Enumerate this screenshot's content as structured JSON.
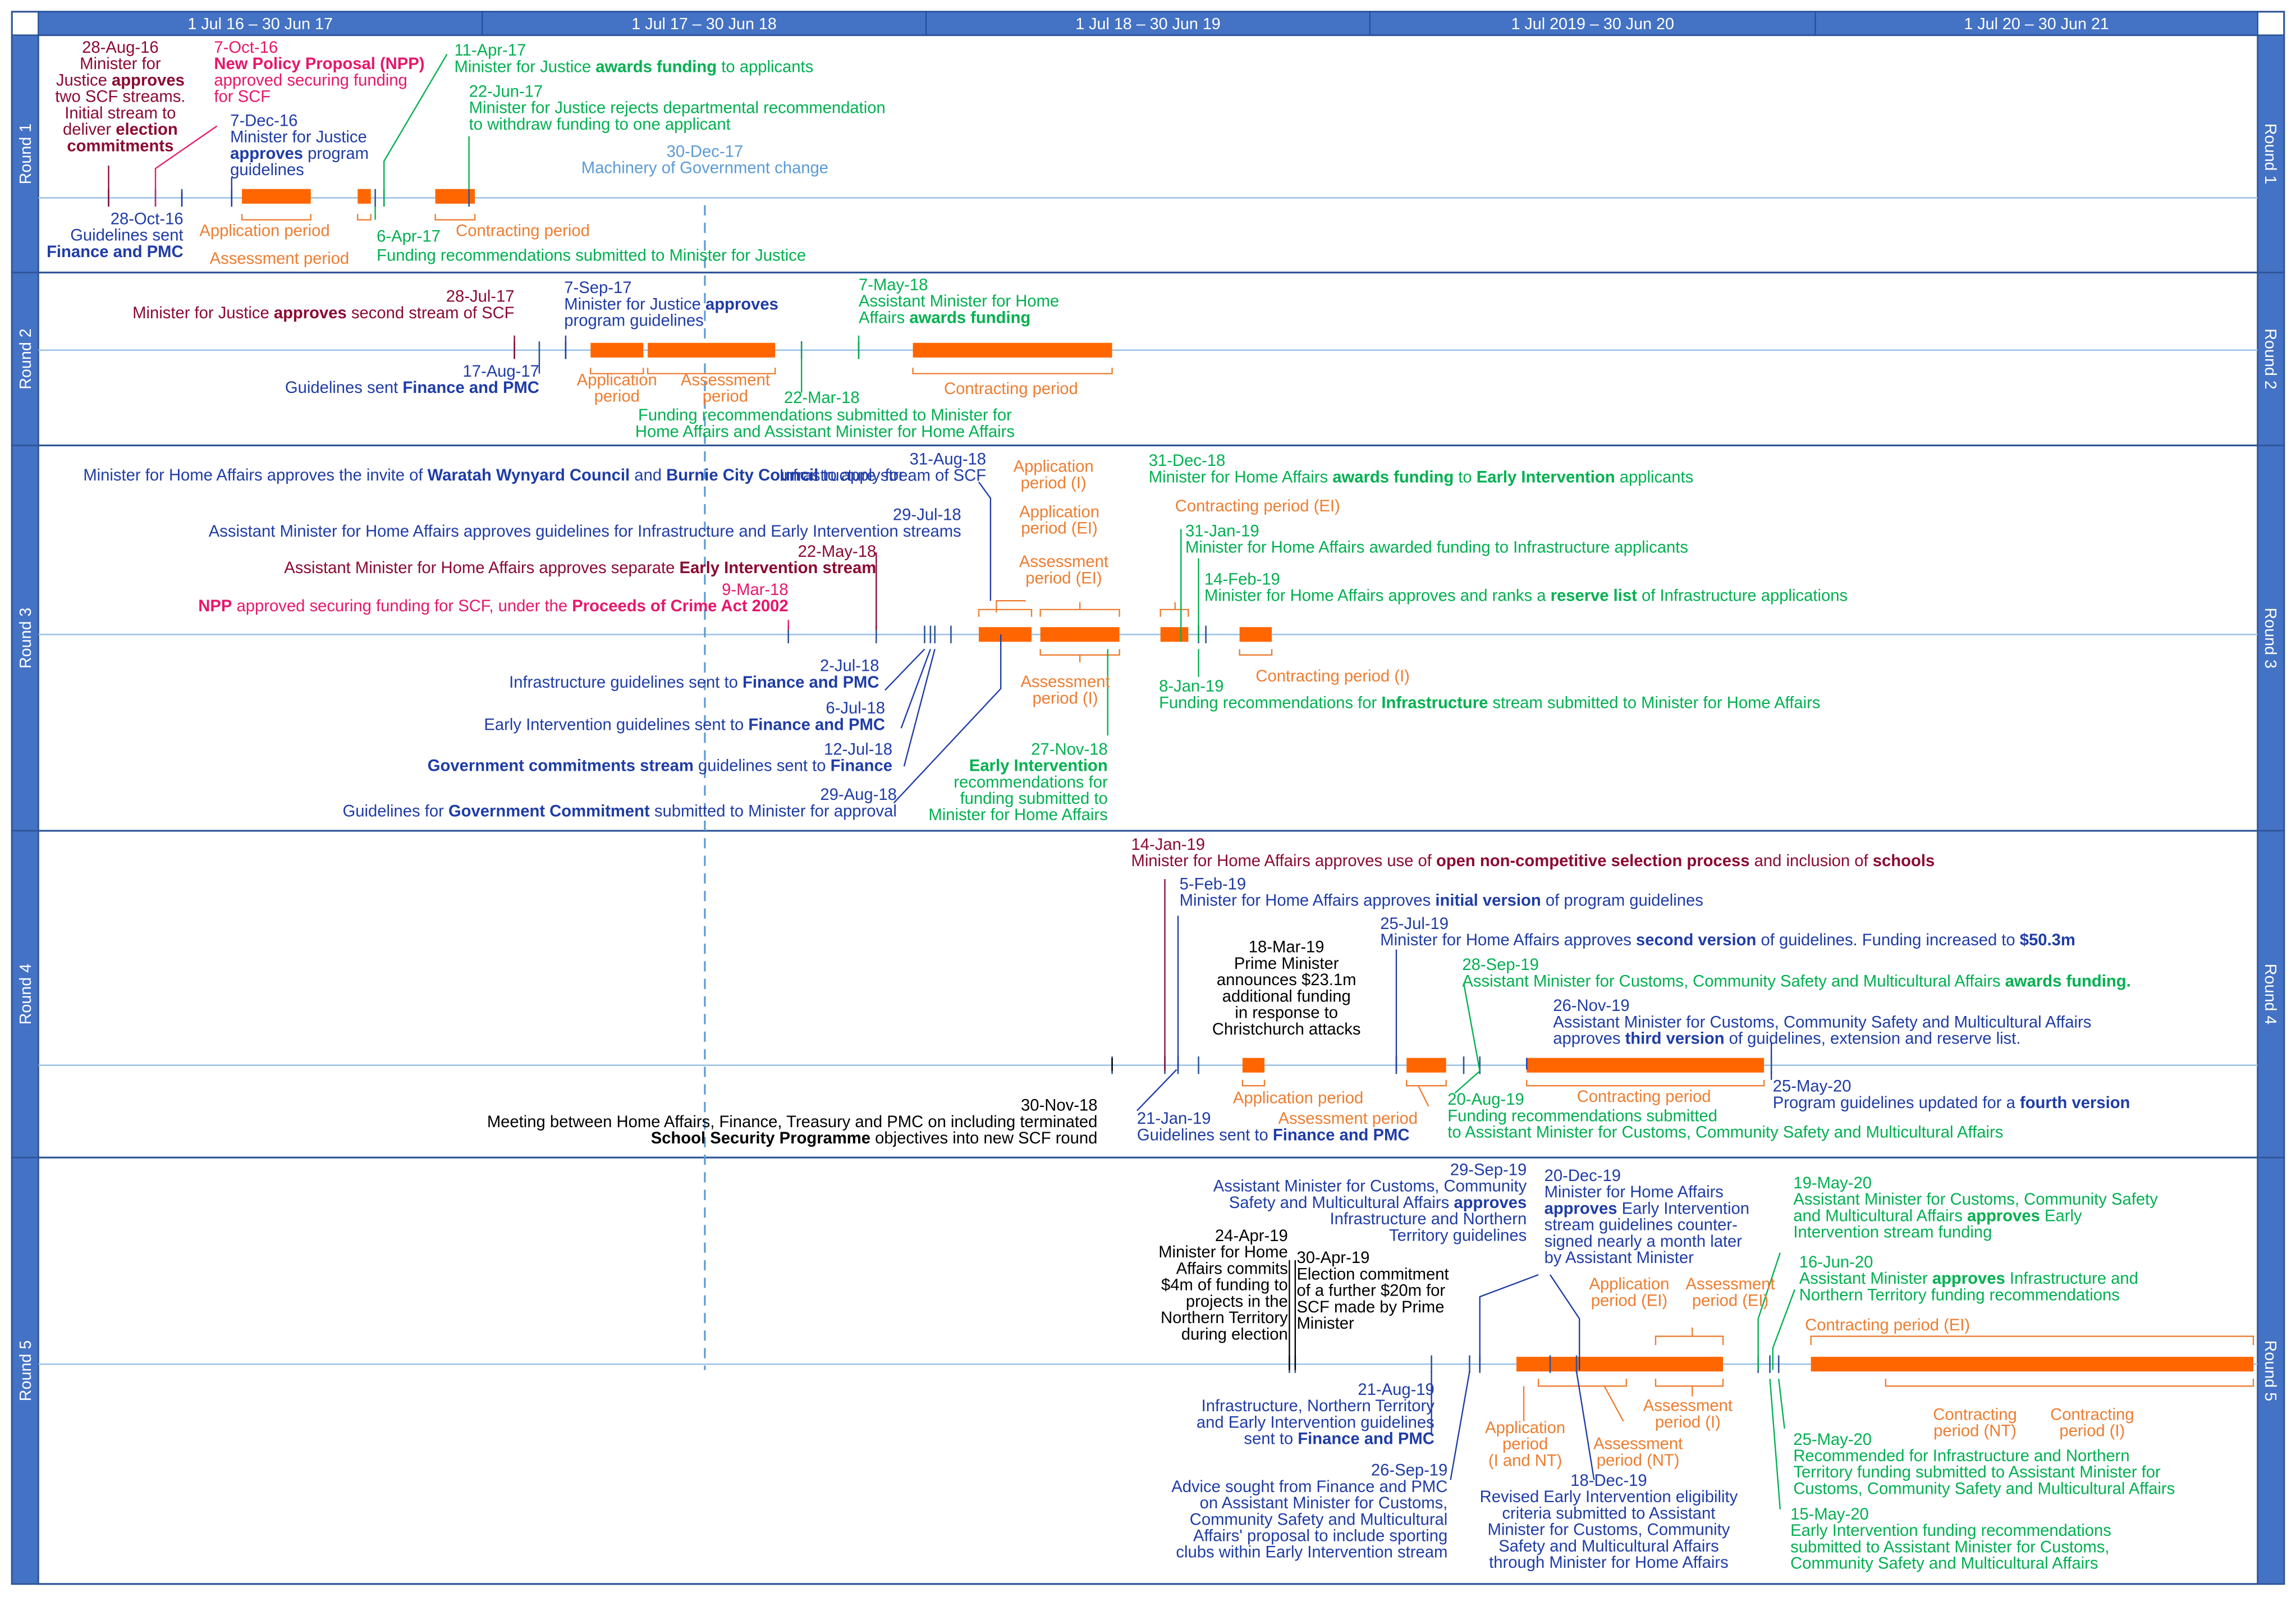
{
  "colors": {
    "header_blue": "#4472C4",
    "frame_blue": "#2F5597",
    "axis_line": "#9DC3E6",
    "bar_orange": "#FF6600",
    "label_orange": "#ED7D31",
    "maroon": "#8B0A32",
    "pink": "#E6176B",
    "dark_blue": "#1F3CA6",
    "green": "#00B050",
    "mog_blue": "#5B9BD5",
    "black": "#000000"
  },
  "years": [
    "1 Jul 16 – 30 Jun 17",
    "1 Jul 17 – 30 Jun 18",
    "1 Jul 18 – 30 Jun 19",
    "1 Jul 2019 – 30 Jun 20",
    "1 Jul 20 – 30 Jun 21"
  ],
  "rounds": [
    "Round 1",
    "Round 2",
    "Round 3",
    "Round 4",
    "Round 5"
  ],
  "mog": {
    "date": "30-Dec-17",
    "text": "Machinery of Government change"
  },
  "annotations": [
    {
      "c": "maroon",
      "lines": [
        [
          "28-Aug-16"
        ],
        [
          "Minister for"
        ],
        [
          "Justice ",
          [
            "approves"
          ]
        ],
        [
          "two SCF streams."
        ],
        [
          "Initial stream to"
        ],
        [
          "deliver ",
          [
            "election"
          ]
        ],
        [
          [
            "commitments"
          ]
        ]
      ]
    },
    {
      "c": "pink",
      "lines": [
        [
          "7-Oct-16"
        ],
        [
          [
            "New Policy Proposal (NPP)"
          ]
        ],
        [
          "approved securing funding"
        ],
        [
          "for SCF"
        ]
      ]
    },
    {
      "c": "dark_blue",
      "lines": [
        [
          "7-Dec-16"
        ],
        [
          "Minister for Justice"
        ],
        [
          [
            "approves"
          ],
          " program"
        ],
        [
          "guidelines"
        ]
      ]
    },
    {
      "c": "green",
      "lines": [
        [
          "11-Apr-17"
        ],
        [
          "Minister for Justice ",
          [
            "awards funding"
          ],
          " to applicants"
        ]
      ]
    },
    {
      "c": "green",
      "lines": [
        [
          "22-Jun-17"
        ],
        [
          "Minister for Justice rejects departmental recommendation"
        ],
        [
          "to withdraw funding to one applicant"
        ]
      ]
    },
    {
      "c": "dark_blue",
      "lines": [
        [
          "28-Oct-16"
        ],
        [
          "Guidelines sent"
        ],
        [
          [
            "Finance and PMC"
          ]
        ]
      ]
    },
    {
      "c": "label_orange",
      "lines": [
        [
          "Application period"
        ]
      ]
    },
    {
      "c": "label_orange",
      "lines": [
        [
          "Assessment period"
        ]
      ]
    },
    {
      "c": "green",
      "lines": [
        [
          "6-Apr-17"
        ]
      ]
    },
    {
      "c": "label_orange",
      "lines": [
        [
          "Contracting period"
        ]
      ]
    },
    {
      "c": "green",
      "lines": [
        [
          "Funding recommendations submitted to Minister for Justice"
        ]
      ]
    },
    {
      "c": "maroon",
      "lines": [
        [
          "28-Jul-17"
        ],
        [
          "Minister for Justice ",
          [
            "approves"
          ],
          " second stream of SCF"
        ]
      ]
    },
    {
      "c": "dark_blue",
      "lines": [
        [
          "7-Sep-17"
        ],
        [
          "Minister for Justice ",
          [
            "approves"
          ]
        ],
        [
          "program guidelines"
        ]
      ]
    },
    {
      "c": "green",
      "lines": [
        [
          "7-May-18"
        ],
        [
          "Assistant Minister for Home"
        ],
        [
          "Affairs ",
          [
            "awards funding"
          ]
        ]
      ]
    },
    {
      "c": "dark_blue",
      "lines": [
        [
          "17-Aug-17"
        ],
        [
          "Guidelines sent ",
          [
            "Finance and PMC"
          ]
        ]
      ]
    },
    {
      "c": "label_orange",
      "lines": [
        [
          "Application"
        ],
        [
          "period"
        ]
      ]
    },
    {
      "c": "label_orange",
      "lines": [
        [
          "Assessment"
        ],
        [
          "period"
        ]
      ]
    },
    {
      "c": "green",
      "lines": [
        [
          "22-Mar-18"
        ]
      ]
    },
    {
      "c": "green",
      "lines": [
        [
          "Funding recommendations submitted to Minister for"
        ],
        [
          "Home Affairs and Assistant Minister for Home Affairs"
        ]
      ]
    },
    {
      "c": "label_orange",
      "lines": [
        [
          "Contracting period"
        ]
      ]
    },
    {
      "c": "dark_blue",
      "lines": [
        [
          "Minister for Home Affairs approves the invite of ",
          [
            "Waratah Wynyard Council"
          ],
          " and ",
          [
            "Burnie City Council"
          ],
          " to apply for"
        ]
      ]
    },
    {
      "c": "dark_blue",
      "lines": [
        [
          "31-Aug-18"
        ],
        [
          "Infrastructure stream of SCF"
        ]
      ]
    },
    {
      "c": "dark_blue",
      "lines": [
        [
          "29-Jul-18"
        ],
        [
          "Assistant Minister for Home Affairs approves guidelines for Infrastructure and Early Intervention streams"
        ]
      ]
    },
    {
      "c": "maroon",
      "lines": [
        [
          "22-May-18"
        ],
        [
          "Assistant Minister for Home Affairs approves separate ",
          [
            "Early Intervention stream"
          ]
        ]
      ]
    },
    {
      "c": "pink",
      "lines": [
        [
          "9-Mar-18"
        ],
        [
          [
            "NPP"
          ],
          " approved securing funding for SCF, under the ",
          [
            "Proceeds of Crime Act 2002"
          ]
        ]
      ]
    },
    {
      "c": "label_orange",
      "lines": [
        [
          "Application"
        ],
        [
          "period (I)"
        ]
      ]
    },
    {
      "c": "label_orange",
      "lines": [
        [
          "Application"
        ],
        [
          "period (EI)"
        ]
      ]
    },
    {
      "c": "label_orange",
      "lines": [
        [
          "Assessment"
        ],
        [
          "period (EI)"
        ]
      ]
    },
    {
      "c": "label_orange",
      "lines": [
        [
          "Assessment"
        ],
        [
          "period (I)"
        ]
      ]
    },
    {
      "c": "green",
      "lines": [
        [
          "31-Dec-18"
        ],
        [
          "Minister for Home Affairs ",
          [
            "awards funding"
          ],
          " to ",
          [
            "Early Intervention"
          ],
          " applicants"
        ]
      ]
    },
    {
      "c": "label_orange",
      "lines": [
        [
          "Contracting period (EI)"
        ]
      ]
    },
    {
      "c": "green",
      "lines": [
        [
          "31-Jan-19"
        ],
        [
          "Minister for Home Affairs awarded funding to Infrastructure applicants"
        ]
      ]
    },
    {
      "c": "green",
      "lines": [
        [
          "14-Feb-19"
        ],
        [
          "Minister for Home Affairs approves and ranks a ",
          [
            "reserve list"
          ],
          " of Infrastructure applications"
        ]
      ]
    },
    {
      "c": "label_orange",
      "lines": [
        [
          "Contracting period (I)"
        ]
      ]
    },
    {
      "c": "green",
      "lines": [
        [
          "8-Jan-19"
        ],
        [
          "Funding recommendations for ",
          [
            "Infrastructure"
          ],
          " stream submitted to Minister for Home Affairs"
        ]
      ]
    },
    {
      "c": "dark_blue",
      "lines": [
        [
          "2-Jul-18"
        ],
        [
          "Infrastructure guidelines sent to ",
          [
            "Finance and PMC"
          ]
        ]
      ]
    },
    {
      "c": "dark_blue",
      "lines": [
        [
          "6-Jul-18"
        ],
        [
          "Early Intervention guidelines sent to ",
          [
            "Finance and PMC"
          ]
        ]
      ]
    },
    {
      "c": "dark_blue",
      "lines": [
        [
          "12-Jul-18"
        ],
        [
          [
            "Government commitments stream"
          ],
          " guidelines sent to ",
          [
            "Finance"
          ]
        ]
      ]
    },
    {
      "c": "dark_blue",
      "lines": [
        [
          "29-Aug-18"
        ],
        [
          "Guidelines for ",
          [
            "Government Commitment"
          ],
          " submitted to Minister for approval"
        ]
      ]
    },
    {
      "c": "green",
      "lines": [
        [
          "27-Nov-18"
        ],
        [
          [
            "Early Intervention"
          ]
        ],
        [
          "recommendations for"
        ],
        [
          "funding submitted to"
        ],
        [
          "Minister for Home Affairs"
        ]
      ]
    },
    {
      "c": "maroon",
      "lines": [
        [
          "14-Jan-19"
        ],
        [
          "Minister for Home Affairs approves use of ",
          [
            "open non-competitive selection process"
          ],
          " and inclusion of ",
          [
            "schools"
          ]
        ]
      ]
    },
    {
      "c": "dark_blue",
      "lines": [
        [
          "5-Feb-19"
        ],
        [
          "Minister for Home Affairs approves ",
          [
            "initial version"
          ],
          " of program guidelines"
        ]
      ]
    },
    {
      "c": "black",
      "lines": [
        [
          "18-Mar-19"
        ],
        [
          "Prime Minister"
        ],
        [
          "announces $23.1m"
        ],
        [
          "additional funding"
        ],
        [
          "in response to"
        ],
        [
          "Christchurch attacks"
        ]
      ]
    },
    {
      "c": "dark_blue",
      "lines": [
        [
          "25-Jul-19"
        ],
        [
          "Minister for Home Affairs approves ",
          [
            "second version"
          ],
          " of guidelines. Funding increased to ",
          [
            "$50.3m"
          ]
        ]
      ]
    },
    {
      "c": "green",
      "lines": [
        [
          "28-Sep-19"
        ],
        [
          "Assistant Minister for Customs, Community Safety and Multicultural Affairs ",
          [
            "awards funding."
          ]
        ]
      ]
    },
    {
      "c": "dark_blue",
      "lines": [
        [
          "26-Nov-19"
        ],
        [
          "Assistant Minister for Customs, Community Safety and Multicultural Affairs"
        ],
        [
          "approves ",
          [
            "third version"
          ],
          " of guidelines, extension and reserve list."
        ]
      ]
    },
    {
      "c": "label_orange",
      "lines": [
        [
          "Application period"
        ]
      ]
    },
    {
      "c": "label_orange",
      "lines": [
        [
          "Assessment period"
        ]
      ]
    },
    {
      "c": "label_orange",
      "lines": [
        [
          "Contracting period"
        ]
      ]
    },
    {
      "c": "black",
      "lines": [
        [
          "30-Nov-18"
        ],
        [
          "Meeting between Home Affairs, Finance, Treasury and PMC on including terminated"
        ],
        [
          [
            "School Security Programme"
          ],
          " objectives into new SCF round"
        ]
      ]
    },
    {
      "c": "dark_blue",
      "lines": [
        [
          "21-Jan-19"
        ],
        [
          "Guidelines sent to ",
          [
            "Finance and PMC"
          ]
        ]
      ]
    },
    {
      "c": "green",
      "lines": [
        [
          "20-Aug-19"
        ],
        [
          "Funding recommendations submitted"
        ],
        [
          "to Assistant Minister for Customs, Community Safety and Multicultural Affairs"
        ]
      ]
    },
    {
      "c": "dark_blue",
      "lines": [
        [
          "25-May-20"
        ],
        [
          "Program guidelines updated for a ",
          [
            "fourth version"
          ]
        ]
      ]
    },
    {
      "c": "dark_blue",
      "lines": [
        [
          "29-Sep-19"
        ],
        [
          "Assistant Minister for Customs, Community"
        ],
        [
          "Safety and Multicultural Affairs ",
          [
            "approves"
          ]
        ],
        [
          "Infrastructure and Northern"
        ],
        [
          "Territory guidelines"
        ]
      ]
    },
    {
      "c": "dark_blue",
      "lines": [
        [
          "20-Dec-19"
        ],
        [
          "Minister for Home Affairs"
        ],
        [
          [
            "approves"
          ],
          " Early Intervention"
        ],
        [
          "stream guidelines counter-"
        ],
        [
          "signed nearly a month later"
        ],
        [
          "by Assistant Minister"
        ]
      ]
    },
    {
      "c": "green",
      "lines": [
        [
          "19-May-20"
        ],
        [
          "Assistant Minister for Customs, Community Safety"
        ],
        [
          "and Multicultural Affairs ",
          [
            "approves"
          ],
          " Early"
        ],
        [
          "Intervention stream funding"
        ]
      ]
    },
    {
      "c": "black",
      "lines": [
        [
          "24-Apr-19"
        ],
        [
          "Minister for Home"
        ],
        [
          "Affairs commits"
        ],
        [
          "$4m of funding to"
        ],
        [
          "projects in the"
        ],
        [
          "Northern Territory"
        ],
        [
          "during election"
        ]
      ]
    },
    {
      "c": "black",
      "lines": [
        [
          "30-Apr-19"
        ],
        [
          "Election commitment"
        ],
        [
          "of a further $20m for"
        ],
        [
          "SCF made by Prime"
        ],
        [
          "Minister"
        ]
      ]
    },
    {
      "c": "label_orange",
      "lines": [
        [
          "Application"
        ],
        [
          "period (EI)"
        ]
      ]
    },
    {
      "c": "label_orange",
      "lines": [
        [
          "Assessment"
        ],
        [
          "period (EI)"
        ]
      ]
    },
    {
      "c": "green",
      "lines": [
        [
          "16-Jun-20"
        ],
        [
          "Assistant Minister ",
          [
            "approves"
          ],
          " Infrastructure and"
        ],
        [
          "Northern Territory funding recommendations"
        ]
      ]
    },
    {
      "c": "label_orange",
      "lines": [
        [
          "Contracting period (EI)"
        ]
      ]
    },
    {
      "c": "dark_blue",
      "lines": [
        [
          "21-Aug-19"
        ],
        [
          "Infrastructure, Northern Territory"
        ],
        [
          "and Early Intervention guidelines"
        ],
        [
          "sent to ",
          [
            "Finance and PMC"
          ]
        ]
      ]
    },
    {
      "c": "label_orange",
      "lines": [
        [
          "Application"
        ],
        [
          "period"
        ],
        [
          "(I and NT)"
        ]
      ]
    },
    {
      "c": "label_orange",
      "lines": [
        [
          "Assessment"
        ],
        [
          "period (I)"
        ]
      ]
    },
    {
      "c": "label_orange",
      "lines": [
        [
          "Assessment"
        ],
        [
          "period (NT)"
        ]
      ]
    },
    {
      "c": "label_orange",
      "lines": [
        [
          "Contracting"
        ],
        [
          "period (NT)"
        ]
      ]
    },
    {
      "c": "label_orange",
      "lines": [
        [
          "Contracting"
        ],
        [
          "period (I)"
        ]
      ]
    },
    {
      "c": "green",
      "lines": [
        [
          "25-May-20"
        ],
        [
          "Recommended for Infrastructure and Northern"
        ],
        [
          "Territory funding submitted to Assistant Minister for"
        ],
        [
          "Customs, Community Safety and Multicultural Affairs"
        ]
      ]
    },
    {
      "c": "dark_blue",
      "lines": [
        [
          "26-Sep-19"
        ],
        [
          "Advice sought from Finance and PMC"
        ],
        [
          "on Assistant Minister for Customs,"
        ],
        [
          "Community Safety and Multicultural"
        ],
        [
          "Affairs' proposal to include sporting"
        ],
        [
          "clubs within Early Intervention stream"
        ]
      ]
    },
    {
      "c": "dark_blue",
      "lines": [
        [
          "18-Dec-19"
        ],
        [
          "Revised Early Intervention eligibility"
        ],
        [
          "criteria submitted to Assistant"
        ],
        [
          "Minister for Customs, Community"
        ],
        [
          "Safety and Multicultural Affairs"
        ],
        [
          "through Minister for Home Affairs"
        ]
      ]
    },
    {
      "c": "green",
      "lines": [
        [
          "15-May-20"
        ],
        [
          "Early Intervention funding recommendations"
        ],
        [
          "submitted to Assistant Minister for Customs,"
        ],
        [
          "Community Safety and Multicultural Affairs"
        ]
      ]
    }
  ]
}
